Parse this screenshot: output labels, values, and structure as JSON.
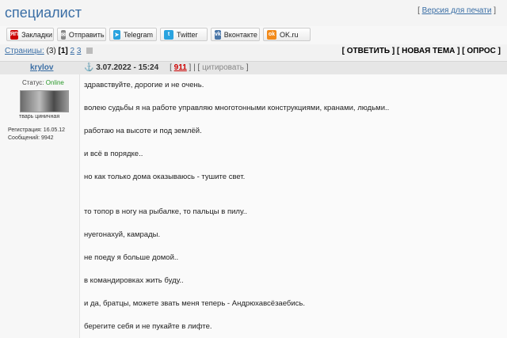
{
  "header": {
    "title": "специалист",
    "print_label": "Версия для печати"
  },
  "share": [
    {
      "label": "Закладки",
      "icon": "yandex-icon",
      "color": "#cc0000"
    },
    {
      "label": "Отправить",
      "icon": "mail-icon",
      "color": "#888888"
    },
    {
      "label": "Telegram",
      "icon": "telegram-icon",
      "color": "#2aa3df"
    },
    {
      "label": "Twitter",
      "icon": "twitter-icon",
      "color": "#2aa3df"
    },
    {
      "label": "Вконтакте",
      "icon": "vk-icon",
      "color": "#4a76a8"
    },
    {
      "label": "OK.ru",
      "icon": "ok-icon",
      "color": "#f28a1a"
    }
  ],
  "pagination": {
    "label": "Страницы:",
    "count": "(3)",
    "current": "[1]",
    "page2": "2",
    "page3": "3"
  },
  "actions": {
    "reply": "ОТВЕТИТЬ",
    "new_topic": "НОВАЯ ТЕМА",
    "poll": "ОПРОС"
  },
  "post": {
    "author": "krylov",
    "date": "3.07.2022 - 15:24",
    "number": "911",
    "cite": "цитировать",
    "status_label": "Статус:",
    "status_value": "Online",
    "avatar_caption": "тварь циничная",
    "reg": "Регистрация: 16.05.12",
    "msgs": "Сообщений: 9942",
    "lines": [
      "здравствуйте, дорогие и не очень.",
      "волею судьбы я на работе управляю многотонными конструкциями, кранами, людьми..",
      "работаю на высоте и под землёй.",
      "и всё в порядке..",
      "но как только дома оказываюсь - тушите свет.",
      "то топор в ногу на рыбалке, то пальцы в пилу..",
      "нуегонахуй, камрады.",
      "не поеду я больше домой..",
      "в командировках жить буду..",
      "и да, братцы, можете звать меня теперь - Андрюхавсёзаебись.",
      "берегите себя и не пукайте в лифте."
    ]
  }
}
